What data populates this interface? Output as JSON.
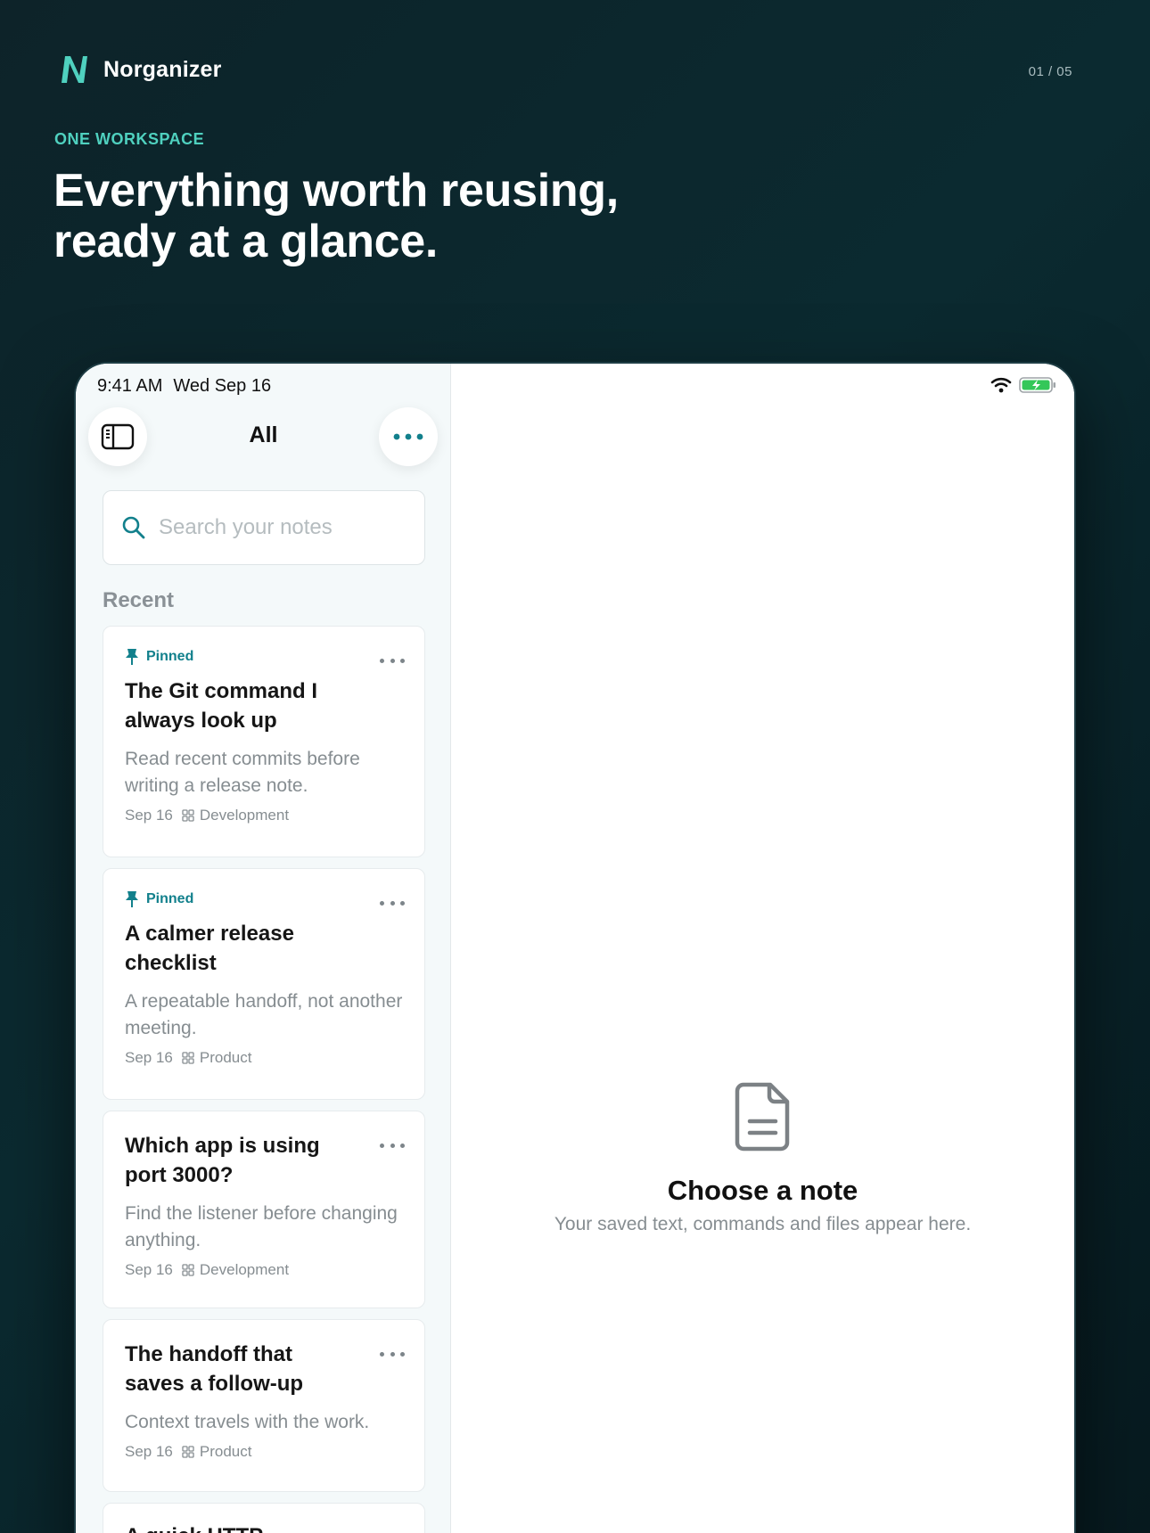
{
  "brand": {
    "name": "Norganizer",
    "pager": "01 / 05"
  },
  "hero": {
    "eyebrow": "ONE WORKSPACE",
    "headline_line1": "Everything worth reusing,",
    "headline_line2": "ready at a glance."
  },
  "status": {
    "time": "9:41 AM",
    "date": "Wed Sep 16"
  },
  "sidebar": {
    "title": "All",
    "search_placeholder": "Search your notes",
    "section": "Recent",
    "cards": [
      {
        "pinned": "Pinned",
        "title": "The Git command I always look up",
        "preview": "Read recent commits before writing a release note.",
        "date": "Sep 16",
        "tag": "Development"
      },
      {
        "pinned": "Pinned",
        "title": "A calmer release checklist",
        "preview": "A repeatable handoff, not another meeting.",
        "date": "Sep 16",
        "tag": "Product"
      },
      {
        "title": "Which app is using port 3000?",
        "preview": "Find the listener before changing anything.",
        "date": "Sep 16",
        "tag": "Development"
      },
      {
        "title": "The handoff that saves a follow-up",
        "preview": "Context travels with the work.",
        "date": "Sep 16",
        "tag": "Product"
      },
      {
        "title": "A quick HTTP"
      }
    ]
  },
  "detail": {
    "empty_title": "Choose a note",
    "empty_subtitle": "Your saved text, commands and files appear here."
  },
  "colors": {
    "accent": "#12808c",
    "brand_teal": "#4fd1bf",
    "battery": "#34c759"
  }
}
